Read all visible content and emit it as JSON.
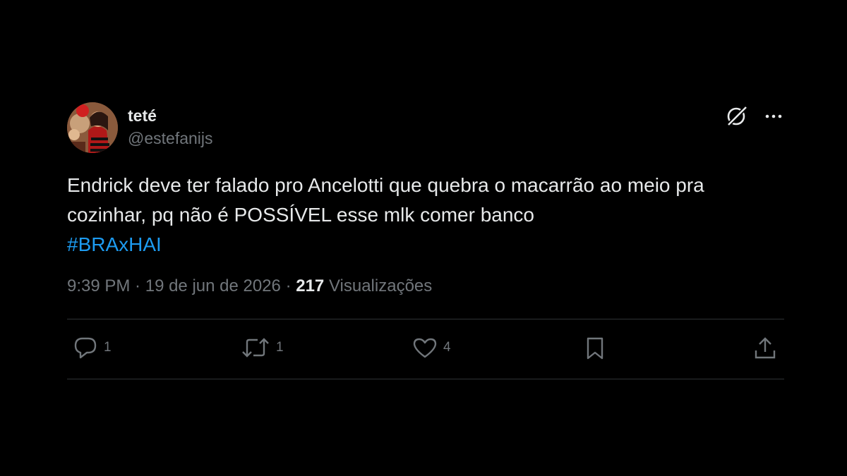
{
  "author": {
    "display_name": "teté",
    "handle": "@estefanijs"
  },
  "tweet": {
    "text_line1": "Endrick deve ter falado pro Ancelotti que quebra o macarrão ao meio pra",
    "text_line2": "cozinhar, pq não é POSSÍVEL esse mlk comer banco",
    "hashtag": "#BRAxHAI"
  },
  "meta": {
    "time": "9:39 PM",
    "separator1": " · ",
    "date": "19 de jun de 2026",
    "separator2": " · ",
    "views_count": "217",
    "views_label": " Visualizações"
  },
  "actions": {
    "replies": "1",
    "retweets": "1",
    "likes": "4"
  },
  "icons": {
    "grok": "grok-icon",
    "more": "more-icon",
    "reply": "reply-icon",
    "retweet": "retweet-icon",
    "like": "heart-icon",
    "bookmark": "bookmark-icon",
    "share": "share-icon"
  },
  "colors": {
    "background": "#000000",
    "text": "#e7e9ea",
    "secondary": "#71767b",
    "link": "#1d9bf0",
    "divider": "#2f3336"
  }
}
